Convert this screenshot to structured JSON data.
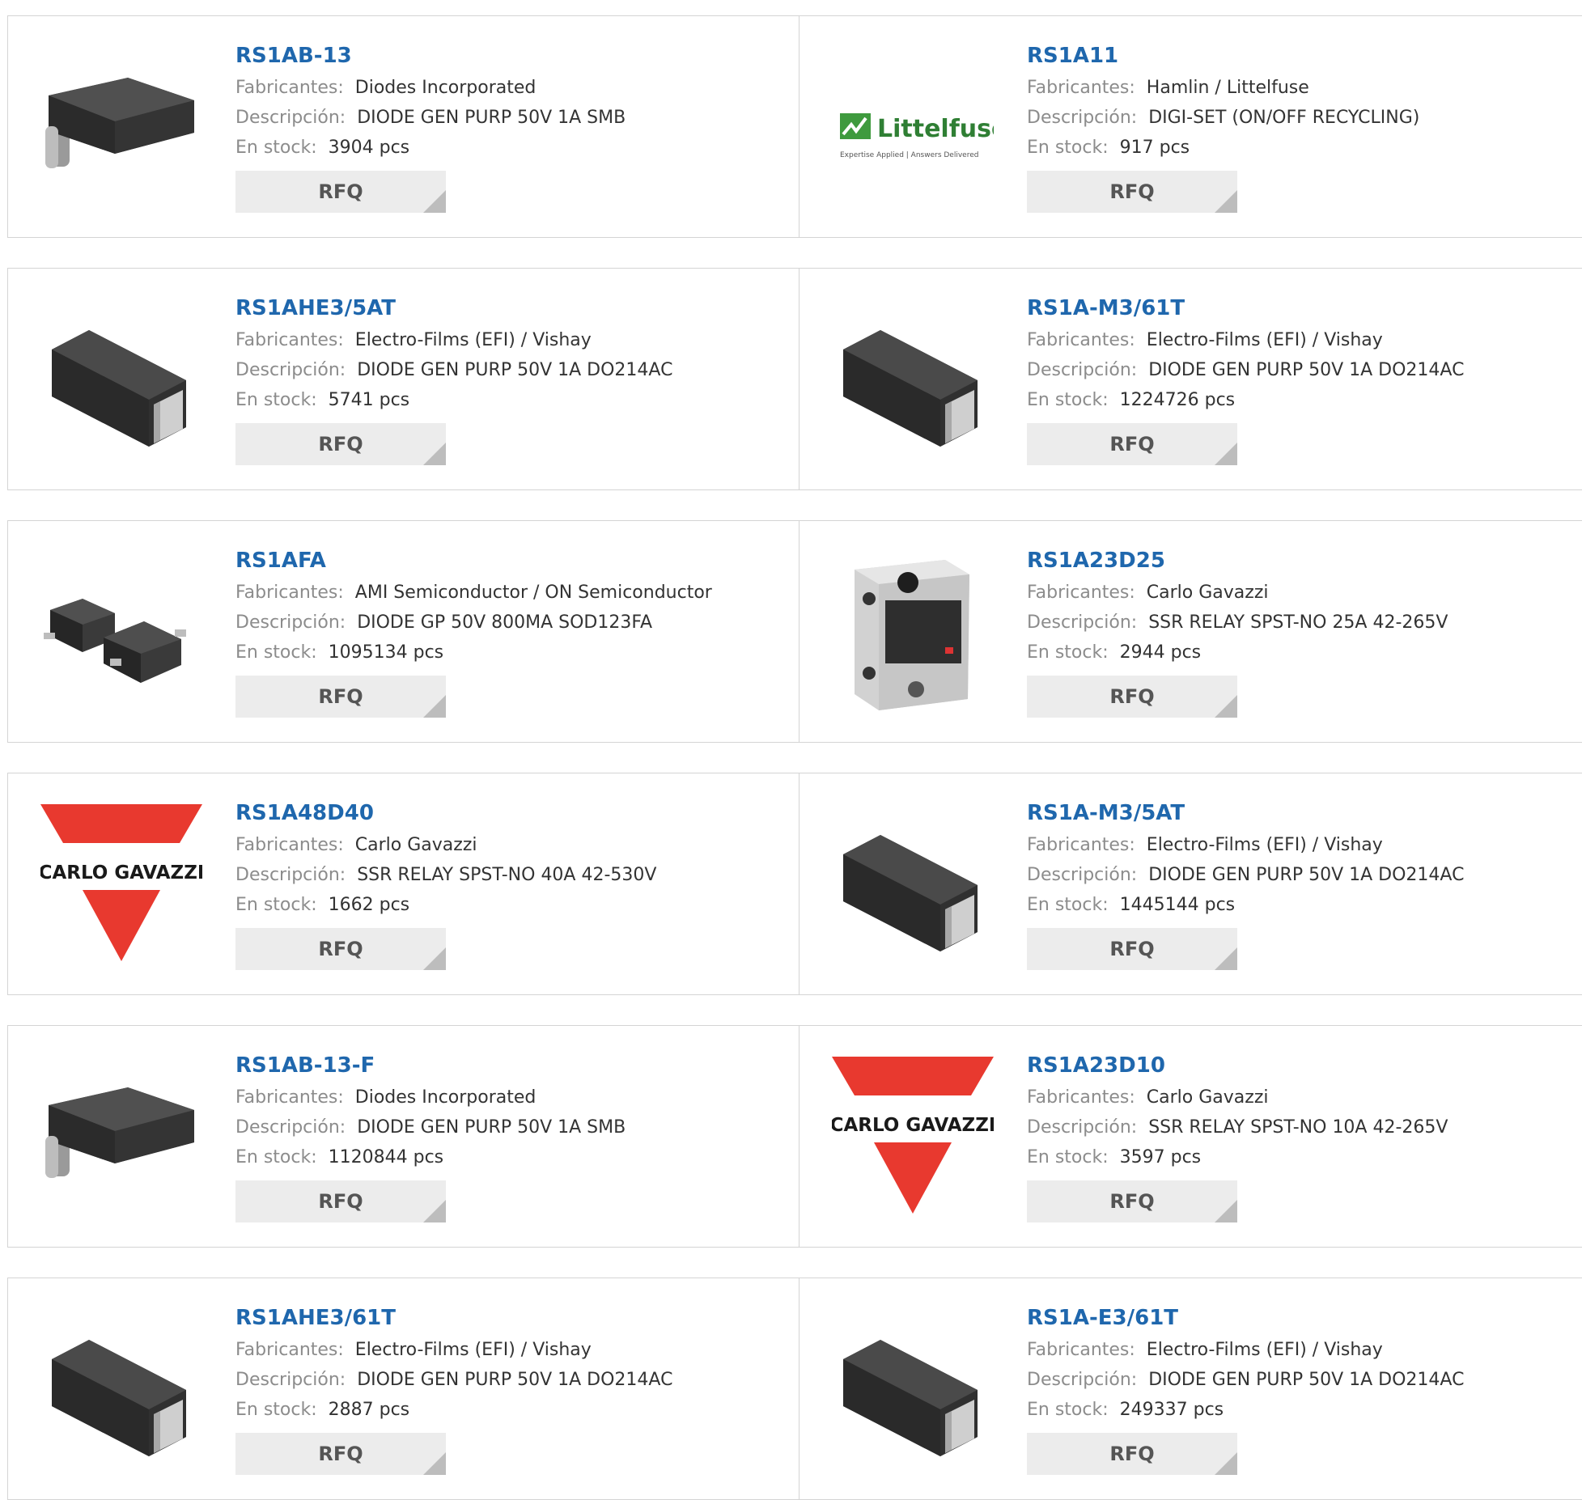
{
  "labels": {
    "manufacturer": "Fabricantes:",
    "description": "Descripción:",
    "stock": "En stock:",
    "rfq": "RFQ"
  },
  "colors": {
    "link": "#1f67ad",
    "label": "#8c8c8c",
    "rfq_bg": "#ececec",
    "border": "#d4d4d4"
  },
  "products": [
    {
      "pn": "RS1AB-13",
      "manufacturer": "Diodes Incorporated",
      "description": "DIODE GEN PURP 50V 1A SMB",
      "stock": "3904 pcs",
      "image": "smb-diode"
    },
    {
      "pn": "RS1A11",
      "manufacturer": "Hamlin / Littelfuse",
      "description": "DIGI-SET (ON/OFF RECYCLING)",
      "stock": "917 pcs",
      "image": "littelfuse-logo",
      "logo_text": "Littelfuse",
      "logo_tagline": "Expertise Applied | Answers Delivered"
    },
    {
      "pn": "RS1AHE3/5AT",
      "manufacturer": "Electro-Films (EFI) / Vishay",
      "description": "DIODE GEN PURP 50V 1A DO214AC",
      "stock": "5741 pcs",
      "image": "do214-diode"
    },
    {
      "pn": "RS1A-M3/61T",
      "manufacturer": "Electro-Films (EFI) / Vishay",
      "description": "DIODE GEN PURP 50V 1A DO214AC",
      "stock": "1224726 pcs",
      "image": "do214-diode"
    },
    {
      "pn": "RS1AFA",
      "manufacturer": "AMI Semiconductor / ON Semiconductor",
      "description": "DIODE GP 50V 800MA SOD123FA",
      "stock": "1095134 pcs",
      "image": "sod123-diodes"
    },
    {
      "pn": "RS1A23D25",
      "manufacturer": "Carlo Gavazzi",
      "description": "SSR RELAY SPST-NO 25A 42-265V",
      "stock": "2944 pcs",
      "image": "ssr-relay"
    },
    {
      "pn": "RS1A48D40",
      "manufacturer": "Carlo Gavazzi",
      "description": "SSR RELAY SPST-NO 40A 42-530V",
      "stock": "1662 pcs",
      "image": "carlo-gavazzi-logo",
      "logo_text": "CARLO GAVAZZI"
    },
    {
      "pn": "RS1A-M3/5AT",
      "manufacturer": "Electro-Films (EFI) / Vishay",
      "description": "DIODE GEN PURP 50V 1A DO214AC",
      "stock": "1445144 pcs",
      "image": "do214-diode"
    },
    {
      "pn": "RS1AB-13-F",
      "manufacturer": "Diodes Incorporated",
      "description": "DIODE GEN PURP 50V 1A SMB",
      "stock": "1120844 pcs",
      "image": "smb-diode"
    },
    {
      "pn": "RS1A23D10",
      "manufacturer": "Carlo Gavazzi",
      "description": "SSR RELAY SPST-NO 10A 42-265V",
      "stock": "3597 pcs",
      "image": "carlo-gavazzi-logo",
      "logo_text": "CARLO GAVAZZI"
    },
    {
      "pn": "RS1AHE3/61T",
      "manufacturer": "Electro-Films (EFI) / Vishay",
      "description": "DIODE GEN PURP 50V 1A DO214AC",
      "stock": "2887 pcs",
      "image": "do214-diode"
    },
    {
      "pn": "RS1A-E3/61T",
      "manufacturer": "Electro-Films (EFI) / Vishay",
      "description": "DIODE GEN PURP 50V 1A DO214AC",
      "stock": "249337 pcs",
      "image": "do214-diode"
    }
  ]
}
